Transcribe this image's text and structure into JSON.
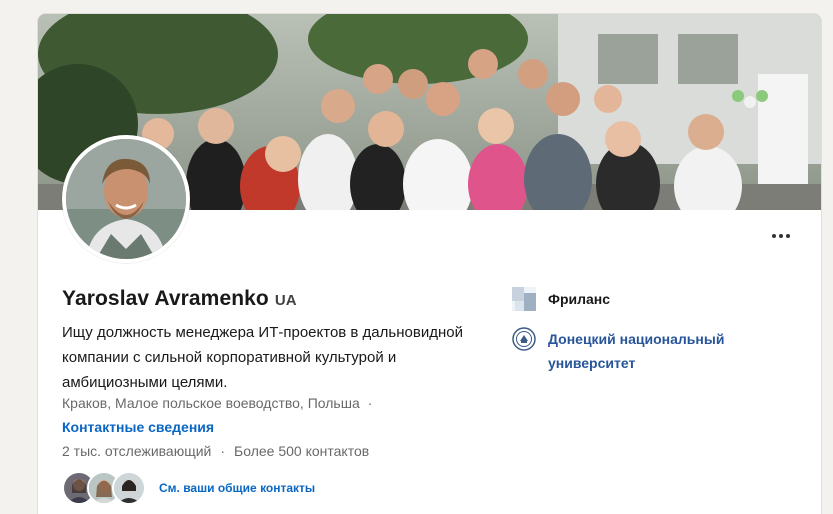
{
  "profile": {
    "name": "Yaroslav Avramenko",
    "pronoun_badge": "UA",
    "headline": "Ищу должность менеджера ИТ-проектов в дальновидной компании с сильной корпоративной культурой и амбициозными целями.",
    "location": "Краков, Малое польское воеводство, Польша",
    "location_separator": "·",
    "contact_info_label": "Контактные сведения",
    "followers": "2 тыс. отслеживающий",
    "stats_separator": "·",
    "connections": "Более 500 контактов",
    "mutual_link": "См. ваши общие контакты"
  },
  "sidebar": {
    "current_company": "Фриланс",
    "education": "Донецкий национальный университет"
  },
  "icons": {
    "more": "more-dots-icon",
    "company_logo": "company-logo-icon",
    "university_logo": "university-seal-icon"
  },
  "colors": {
    "link_blue": "#0a66c2",
    "university_blue": "#28559a",
    "page_bg": "#f3f2ef"
  }
}
